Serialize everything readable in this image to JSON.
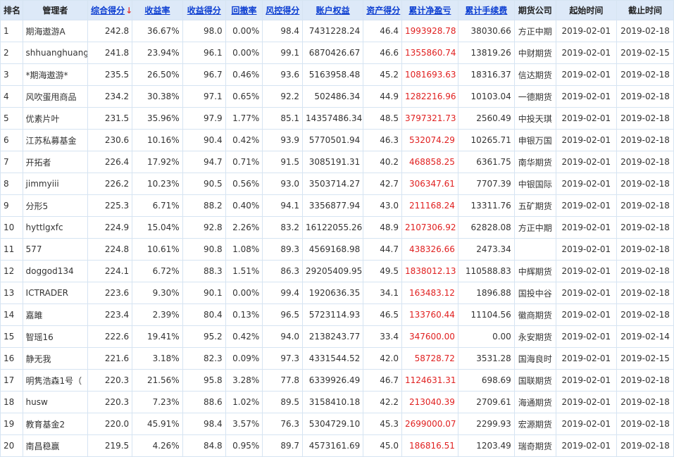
{
  "table": {
    "headers": [
      {
        "key": "rank",
        "label": "排名",
        "sortable": false
      },
      {
        "key": "manager",
        "label": "管理者",
        "sortable": false
      },
      {
        "key": "total_score",
        "label": "综合得分",
        "sortable": true,
        "sorted": true,
        "sort_icon": "↓"
      },
      {
        "key": "return_rate",
        "label": "收益率",
        "sortable": true
      },
      {
        "key": "return_score",
        "label": "收益得分",
        "sortable": true
      },
      {
        "key": "drawdown",
        "label": "回撤率",
        "sortable": true
      },
      {
        "key": "risk_score",
        "label": "风控得分",
        "sortable": true
      },
      {
        "key": "equity",
        "label": "账户权益",
        "sortable": true
      },
      {
        "key": "asset_score",
        "label": "资产得分",
        "sortable": true
      },
      {
        "key": "net_profit",
        "label": "累计净盈亏",
        "sortable": true
      },
      {
        "key": "fees",
        "label": "累计手续费",
        "sortable": true
      },
      {
        "key": "company",
        "label": "期货公司",
        "sortable": false
      },
      {
        "key": "start",
        "label": "起始时间",
        "sortable": false
      },
      {
        "key": "end",
        "label": "截止时间",
        "sortable": false
      }
    ],
    "rows": [
      {
        "rank": "1",
        "manager": "期海遨游A",
        "total_score": "242.8",
        "return_rate": "36.67%",
        "return_score": "98.0",
        "drawdown": "0.00%",
        "risk_score": "98.4",
        "equity": "7431228.24",
        "asset_score": "46.4",
        "net_profit": "1993928.78",
        "fees": "38030.66",
        "company": "方正中期",
        "start": "2019-02-01",
        "end": "2019-02-18"
      },
      {
        "rank": "2",
        "manager": "shhuanghuang",
        "total_score": "241.8",
        "return_rate": "23.94%",
        "return_score": "96.1",
        "drawdown": "0.00%",
        "risk_score": "99.1",
        "equity": "6870426.67",
        "asset_score": "46.6",
        "net_profit": "1355860.74",
        "fees": "13819.26",
        "company": "中财期货",
        "start": "2019-02-01",
        "end": "2019-02-15"
      },
      {
        "rank": "3",
        "manager": "*期海遨游*",
        "total_score": "235.5",
        "return_rate": "26.50%",
        "return_score": "96.7",
        "drawdown": "0.46%",
        "risk_score": "93.6",
        "equity": "5163958.48",
        "asset_score": "45.2",
        "net_profit": "1081693.63",
        "fees": "18316.37",
        "company": "信达期货",
        "start": "2019-02-01",
        "end": "2019-02-18"
      },
      {
        "rank": "4",
        "manager": "风吹蛋甩商品",
        "total_score": "234.2",
        "return_rate": "30.38%",
        "return_score": "97.1",
        "drawdown": "0.65%",
        "risk_score": "92.2",
        "equity": "502486.34",
        "asset_score": "44.9",
        "net_profit": "1282216.96",
        "fees": "10103.04",
        "company": "一德期货",
        "start": "2019-02-01",
        "end": "2019-02-18"
      },
      {
        "rank": "5",
        "manager": "优素片叶",
        "total_score": "231.5",
        "return_rate": "35.96%",
        "return_score": "97.9",
        "drawdown": "1.77%",
        "risk_score": "85.1",
        "equity": "14357486.34",
        "asset_score": "48.5",
        "net_profit": "3797321.73",
        "fees": "2560.49",
        "company": "中投天琪",
        "start": "2019-02-01",
        "end": "2019-02-18"
      },
      {
        "rank": "6",
        "manager": "江苏私募基金",
        "total_score": "230.6",
        "return_rate": "10.16%",
        "return_score": "90.4",
        "drawdown": "0.42%",
        "risk_score": "93.9",
        "equity": "5770501.94",
        "asset_score": "46.3",
        "net_profit": "532074.29",
        "fees": "10265.71",
        "company": "申银万国",
        "start": "2019-02-01",
        "end": "2019-02-18"
      },
      {
        "rank": "7",
        "manager": "开拓者",
        "total_score": "226.4",
        "return_rate": "17.92%",
        "return_score": "94.7",
        "drawdown": "0.71%",
        "risk_score": "91.5",
        "equity": "3085191.31",
        "asset_score": "40.2",
        "net_profit": "468858.25",
        "fees": "6361.75",
        "company": "南华期货",
        "start": "2019-02-01",
        "end": "2019-02-18"
      },
      {
        "rank": "8",
        "manager": "jimmyiii",
        "total_score": "226.2",
        "return_rate": "10.23%",
        "return_score": "90.5",
        "drawdown": "0.56%",
        "risk_score": "93.0",
        "equity": "3503714.27",
        "asset_score": "42.7",
        "net_profit": "306347.61",
        "fees": "7707.39",
        "company": "中银国际",
        "start": "2019-02-01",
        "end": "2019-02-18"
      },
      {
        "rank": "9",
        "manager": "分形5",
        "total_score": "225.3",
        "return_rate": "6.71%",
        "return_score": "88.2",
        "drawdown": "0.40%",
        "risk_score": "94.1",
        "equity": "3356877.94",
        "asset_score": "43.0",
        "net_profit": "211168.24",
        "fees": "13311.76",
        "company": "五矿期货",
        "start": "2019-02-01",
        "end": "2019-02-18"
      },
      {
        "rank": "10",
        "manager": "hyttlgxfc",
        "total_score": "224.9",
        "return_rate": "15.04%",
        "return_score": "92.8",
        "drawdown": "2.26%",
        "risk_score": "83.2",
        "equity": "16122055.26",
        "asset_score": "48.9",
        "net_profit": "2107306.92",
        "fees": "62828.08",
        "company": "方正中期",
        "start": "2019-02-01",
        "end": "2019-02-18"
      },
      {
        "rank": "11",
        "manager": "577",
        "total_score": "224.8",
        "return_rate": "10.61%",
        "return_score": "90.8",
        "drawdown": "1.08%",
        "risk_score": "89.3",
        "equity": "4569168.98",
        "asset_score": "44.7",
        "net_profit": "438326.66",
        "fees": "2473.34",
        "company": "",
        "start": "2019-02-01",
        "end": "2019-02-18"
      },
      {
        "rank": "12",
        "manager": "doggod134",
        "total_score": "224.1",
        "return_rate": "6.72%",
        "return_score": "88.3",
        "drawdown": "1.51%",
        "risk_score": "86.3",
        "equity": "29205409.95",
        "asset_score": "49.5",
        "net_profit": "1838012.13",
        "fees": "110588.83",
        "company": "中辉期货",
        "start": "2019-02-01",
        "end": "2019-02-18"
      },
      {
        "rank": "13",
        "manager": "ICTRADER",
        "total_score": "223.6",
        "return_rate": "9.30%",
        "return_score": "90.1",
        "drawdown": "0.00%",
        "risk_score": "99.4",
        "equity": "1920636.35",
        "asset_score": "34.1",
        "net_profit": "163483.12",
        "fees": "1896.88",
        "company": "国投中谷",
        "start": "2019-02-01",
        "end": "2019-02-18"
      },
      {
        "rank": "14",
        "manager": "嘉雎",
        "total_score": "223.4",
        "return_rate": "2.39%",
        "return_score": "80.4",
        "drawdown": "0.13%",
        "risk_score": "96.5",
        "equity": "5723114.93",
        "asset_score": "46.5",
        "net_profit": "133760.44",
        "fees": "11104.56",
        "company": "徽商期货",
        "start": "2019-02-01",
        "end": "2019-02-18"
      },
      {
        "rank": "15",
        "manager": "智瑶16",
        "total_score": "222.6",
        "return_rate": "19.41%",
        "return_score": "95.2",
        "drawdown": "0.42%",
        "risk_score": "94.0",
        "equity": "2138243.77",
        "asset_score": "33.4",
        "net_profit": "347600.00",
        "fees": "0.00",
        "company": "永安期货",
        "start": "2019-02-01",
        "end": "2019-02-14"
      },
      {
        "rank": "16",
        "manager": "静无我",
        "total_score": "221.6",
        "return_rate": "3.18%",
        "return_score": "82.3",
        "drawdown": "0.09%",
        "risk_score": "97.3",
        "equity": "4331544.52",
        "asset_score": "42.0",
        "net_profit": "58728.72",
        "fees": "3531.28",
        "company": "国海良时",
        "start": "2019-02-01",
        "end": "2019-02-15"
      },
      {
        "rank": "17",
        "manager": "明隽浩森1号（",
        "total_score": "220.3",
        "return_rate": "21.56%",
        "return_score": "95.8",
        "drawdown": "3.28%",
        "risk_score": "77.8",
        "equity": "6339926.49",
        "asset_score": "46.7",
        "net_profit": "1124631.31",
        "fees": "698.69",
        "company": "国联期货",
        "start": "2019-02-01",
        "end": "2019-02-18"
      },
      {
        "rank": "18",
        "manager": "husw",
        "total_score": "220.3",
        "return_rate": "7.23%",
        "return_score": "88.6",
        "drawdown": "1.02%",
        "risk_score": "89.5",
        "equity": "3158410.18",
        "asset_score": "42.2",
        "net_profit": "213040.39",
        "fees": "2709.61",
        "company": "海通期货",
        "start": "2019-02-01",
        "end": "2019-02-18"
      },
      {
        "rank": "19",
        "manager": "教育基金2",
        "total_score": "220.0",
        "return_rate": "45.91%",
        "return_score": "98.4",
        "drawdown": "3.57%",
        "risk_score": "76.3",
        "equity": "5304729.10",
        "asset_score": "45.3",
        "net_profit": "2699000.07",
        "fees": "2299.93",
        "company": "宏源期货",
        "start": "2019-02-01",
        "end": "2019-02-18"
      },
      {
        "rank": "20",
        "manager": "南昌稳赢",
        "total_score": "219.5",
        "return_rate": "4.26%",
        "return_score": "84.8",
        "drawdown": "0.95%",
        "risk_score": "89.7",
        "equity": "4573161.69",
        "asset_score": "45.0",
        "net_profit": "186816.51",
        "fees": "1203.49",
        "company": "瑞奇期货",
        "start": "2019-02-01",
        "end": "2019-02-18"
      }
    ]
  },
  "colors": {
    "header_bg": "#dde9f8",
    "grid_line": "#d6e4f2",
    "link": "#0b3dd1",
    "profit": "#e02020",
    "sort_arrow": "#e23a3a"
  }
}
